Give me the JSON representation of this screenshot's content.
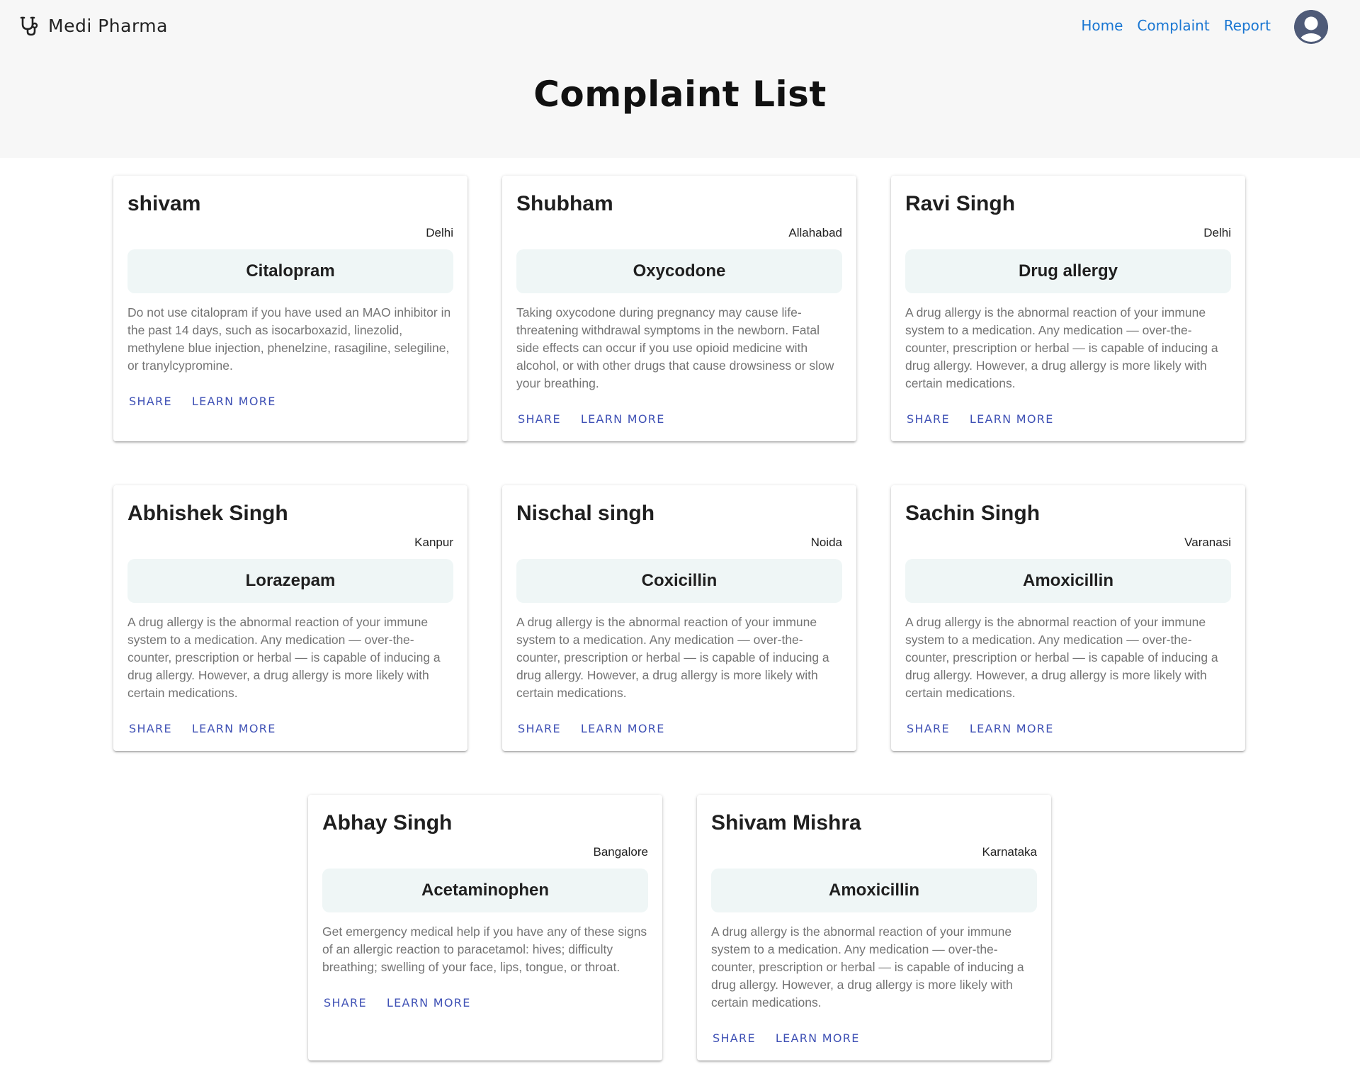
{
  "brand": {
    "name": "Medi Pharma",
    "icon": "stethoscope-icon"
  },
  "nav": {
    "links": [
      "Home",
      "Complaint",
      "Report"
    ],
    "avatar_icon": "user-avatar-icon"
  },
  "page": {
    "title": "Complaint List"
  },
  "colors": {
    "nav_link": "#1976d2",
    "action": "#3f51b5",
    "drug_box_bg": "#eff6f6",
    "header_bg": "#f7f7f7"
  },
  "cards": [
    {
      "name": "shivam",
      "city": "Delhi",
      "drug": "Citalopram",
      "description": "Do not use citalopram if you have used an MAO inhibitor in the past 14 days, such as isocarboxazid, linezolid, methylene blue injection, phenelzine, rasagiline, selegiline, or tranylcypromine.",
      "share": "SHARE",
      "learn_more": "LEARN MORE"
    },
    {
      "name": "Shubham",
      "city": "Allahabad",
      "drug": "Oxycodone",
      "description": "Taking oxycodone during pregnancy may cause life-threatening withdrawal symptoms in the newborn. Fatal side effects can occur if you use opioid medicine with alcohol, or with other drugs that cause drowsiness or slow your breathing.",
      "share": "SHARE",
      "learn_more": "LEARN MORE"
    },
    {
      "name": "Ravi Singh",
      "city": "Delhi",
      "drug": "Drug allergy",
      "description": "A drug allergy is the abnormal reaction of your immune system to a medication. Any medication — over-the-counter, prescription or herbal — is capable of inducing a drug allergy. However, a drug allergy is more likely with certain medications.",
      "share": "SHARE",
      "learn_more": "LEARN MORE"
    },
    {
      "name": "Abhishek Singh",
      "city": "Kanpur",
      "drug": "Lorazepam",
      "description": "A drug allergy is the abnormal reaction of your immune system to a medication. Any medication — over-the-counter, prescription or herbal — is capable of inducing a drug allergy. However, a drug allergy is more likely with certain medications.",
      "share": "SHARE",
      "learn_more": "LEARN MORE"
    },
    {
      "name": "Nischal singh",
      "city": "Noida",
      "drug": "Coxicillin",
      "description": "A drug allergy is the abnormal reaction of your immune system to a medication. Any medication — over-the-counter, prescription or herbal — is capable of inducing a drug allergy. However, a drug allergy is more likely with certain medications.",
      "share": "SHARE",
      "learn_more": "LEARN MORE"
    },
    {
      "name": "Sachin Singh",
      "city": "Varanasi",
      "drug": "Amoxicillin",
      "description": "A drug allergy is the abnormal reaction of your immune system to a medication. Any medication — over-the-counter, prescription or herbal — is capable of inducing a drug allergy. However, a drug allergy is more likely with certain medications.",
      "share": "SHARE",
      "learn_more": "LEARN MORE"
    },
    {
      "name": "Abhay Singh",
      "city": "Bangalore",
      "drug": "Acetaminophen",
      "description": "Get emergency medical help if you have any of these signs of an allergic reaction to paracetamol: hives; difficulty breathing; swelling of your face, lips, tongue, or throat.",
      "share": "SHARE",
      "learn_more": "LEARN MORE"
    },
    {
      "name": "Shivam Mishra",
      "city": "Karnataka",
      "drug": "Amoxicillin",
      "description": "A drug allergy is the abnormal reaction of your immune system to a medication. Any medication — over-the-counter, prescription or herbal — is capable of inducing a drug allergy. However, a drug allergy is more likely with certain medications.",
      "share": "SHARE",
      "learn_more": "LEARN MORE"
    }
  ]
}
